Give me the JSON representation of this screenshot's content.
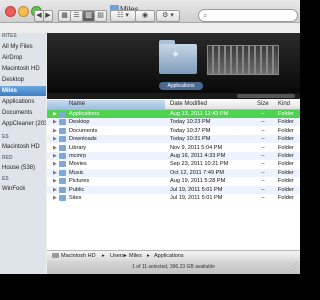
{
  "window": {
    "title": "Miles"
  },
  "toolbar": {
    "back": "◀",
    "forward": "▶",
    "view_icons": "▦",
    "view_list": "☰",
    "view_columns": "▥",
    "view_flow": "▤",
    "arrange": "☷ ▾",
    "quicklook": "◉",
    "action": "⚙ ▾"
  },
  "search": {
    "value": "",
    "placeholder": ""
  },
  "sidebar": {
    "sections": [
      "RITES",
      "ES",
      "RED",
      "ES"
    ],
    "items": [
      {
        "label": "All My Files"
      },
      {
        "label": "AirDrop"
      },
      {
        "label": "Macintosh HD"
      },
      {
        "label": "Desktop"
      },
      {
        "label": "Miles",
        "selected": true
      },
      {
        "label": "Applications"
      },
      {
        "label": "Documents"
      },
      {
        "label": "AppCleaner (203)"
      },
      {
        "label": "Macintosh HD"
      },
      {
        "label": "House (538)"
      },
      {
        "label": "WinFock"
      }
    ]
  },
  "coverflow": {
    "caption": "Applications"
  },
  "columns": {
    "name": "Name",
    "date": "Date Modified",
    "size": "Size",
    "kind": "Kind"
  },
  "files": [
    {
      "name": "Applications",
      "date": "Aug 13, 2011 12:43 PM",
      "size": "--",
      "kind": "Folder",
      "selected": true
    },
    {
      "name": "Desktop",
      "date": "Today 10:23 PM",
      "size": "--",
      "kind": "Folder"
    },
    {
      "name": "Documents",
      "date": "Today 10:37 PM",
      "size": "--",
      "kind": "Folder"
    },
    {
      "name": "Downloads",
      "date": "Today 10:31 PM",
      "size": "--",
      "kind": "Folder"
    },
    {
      "name": "Library",
      "date": "Nov 9, 2011 5:04 PM",
      "size": "--",
      "kind": "Folder"
    },
    {
      "name": "mcmrp",
      "date": "Aug 16, 2011 4:33 PM",
      "size": "--",
      "kind": "Folder"
    },
    {
      "name": "Movies",
      "date": "Sep 23, 2011 10:21 PM",
      "size": "--",
      "kind": "Folder"
    },
    {
      "name": "Music",
      "date": "Oct 12, 2011 7:49 PM",
      "size": "--",
      "kind": "Folder"
    },
    {
      "name": "Pictures",
      "date": "Aug 19, 2011 5:28 PM",
      "size": "--",
      "kind": "Folder"
    },
    {
      "name": "Public",
      "date": "Jul 19, 2011 5:01 PM",
      "size": "--",
      "kind": "Folder"
    },
    {
      "name": "Sites",
      "date": "Jul 19, 2011 5:01 PM",
      "size": "--",
      "kind": "Folder"
    }
  ],
  "pathbar": {
    "segments": [
      "Macintosh HD",
      "Users",
      "Miles",
      "Applications"
    ],
    "separator": "▸"
  },
  "status": {
    "text": "1 of 11 selected, 396.23 GB available"
  }
}
